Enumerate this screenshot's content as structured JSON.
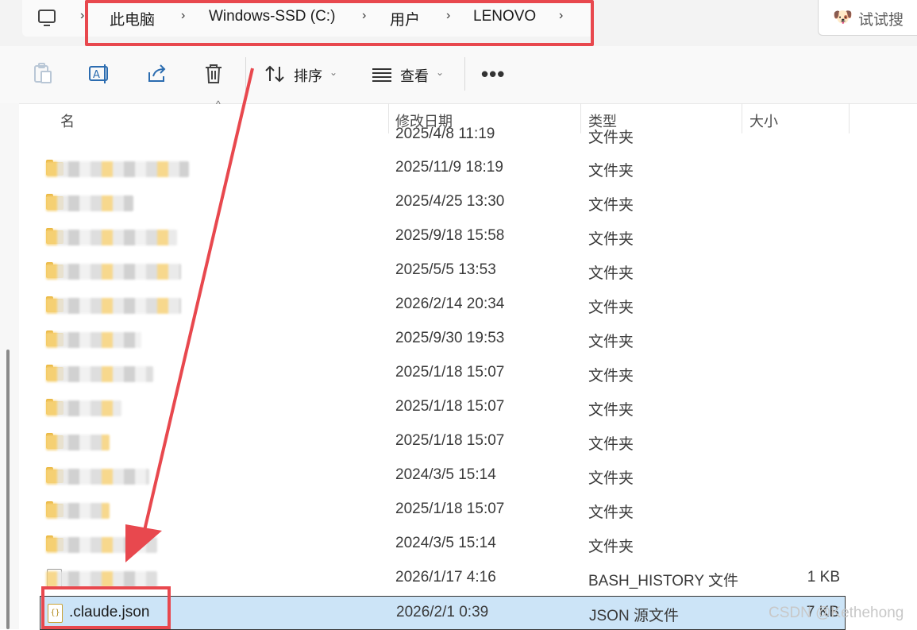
{
  "address": {
    "crumbs": [
      "此电脑",
      "Windows-SSD (C:)",
      "用户",
      "LENOVO"
    ],
    "separator": "›"
  },
  "search": {
    "emoji": "🐶",
    "label": "试试搜"
  },
  "toolbar": {
    "sort_label": "排序",
    "view_label": "查看",
    "more_label": "•••"
  },
  "columns": {
    "name": "名称",
    "name_visible": "名",
    "modified": "修改日期",
    "type": "类型",
    "size": "大小"
  },
  "partial_row": {
    "date": "2025/4/8 11:19",
    "type": "文件夹"
  },
  "rows": [
    {
      "date": "2025/11/9 18:19",
      "type": "文件夹",
      "size": ""
    },
    {
      "date": "2025/4/25 13:30",
      "type": "文件夹",
      "size": ""
    },
    {
      "date": "2025/9/18 15:58",
      "type": "文件夹",
      "size": ""
    },
    {
      "date": "2025/5/5 13:53",
      "type": "文件夹",
      "size": ""
    },
    {
      "date": "2026/2/14 20:34",
      "type": "文件夹",
      "size": ""
    },
    {
      "date": "2025/9/30 19:53",
      "type": "文件夹",
      "size": ""
    },
    {
      "date": "2025/1/18 15:07",
      "type": "文件夹",
      "size": ""
    },
    {
      "date": "2025/1/18 15:07",
      "type": "文件夹",
      "size": ""
    },
    {
      "date": "2025/1/18 15:07",
      "type": "文件夹",
      "size": ""
    },
    {
      "date": "2024/3/5 15:14",
      "type": "文件夹",
      "size": ""
    },
    {
      "date": "2025/1/18 15:07",
      "type": "文件夹",
      "size": ""
    },
    {
      "date": "2024/3/5 15:14",
      "type": "文件夹",
      "size": ""
    },
    {
      "date": "2026/1/17 4:16",
      "type": "BASH_HISTORY 文件",
      "size": "1 KB"
    }
  ],
  "selected_row": {
    "name": ".claude.json",
    "date": "2026/2/1 0:39",
    "type": "JSON 源文件",
    "size": "7 KB"
  },
  "watermark": "CSDN @Kethehong",
  "colors": {
    "annotation": "#e8484e",
    "selection": "#cce4f7",
    "folder": "#f4c54b"
  }
}
